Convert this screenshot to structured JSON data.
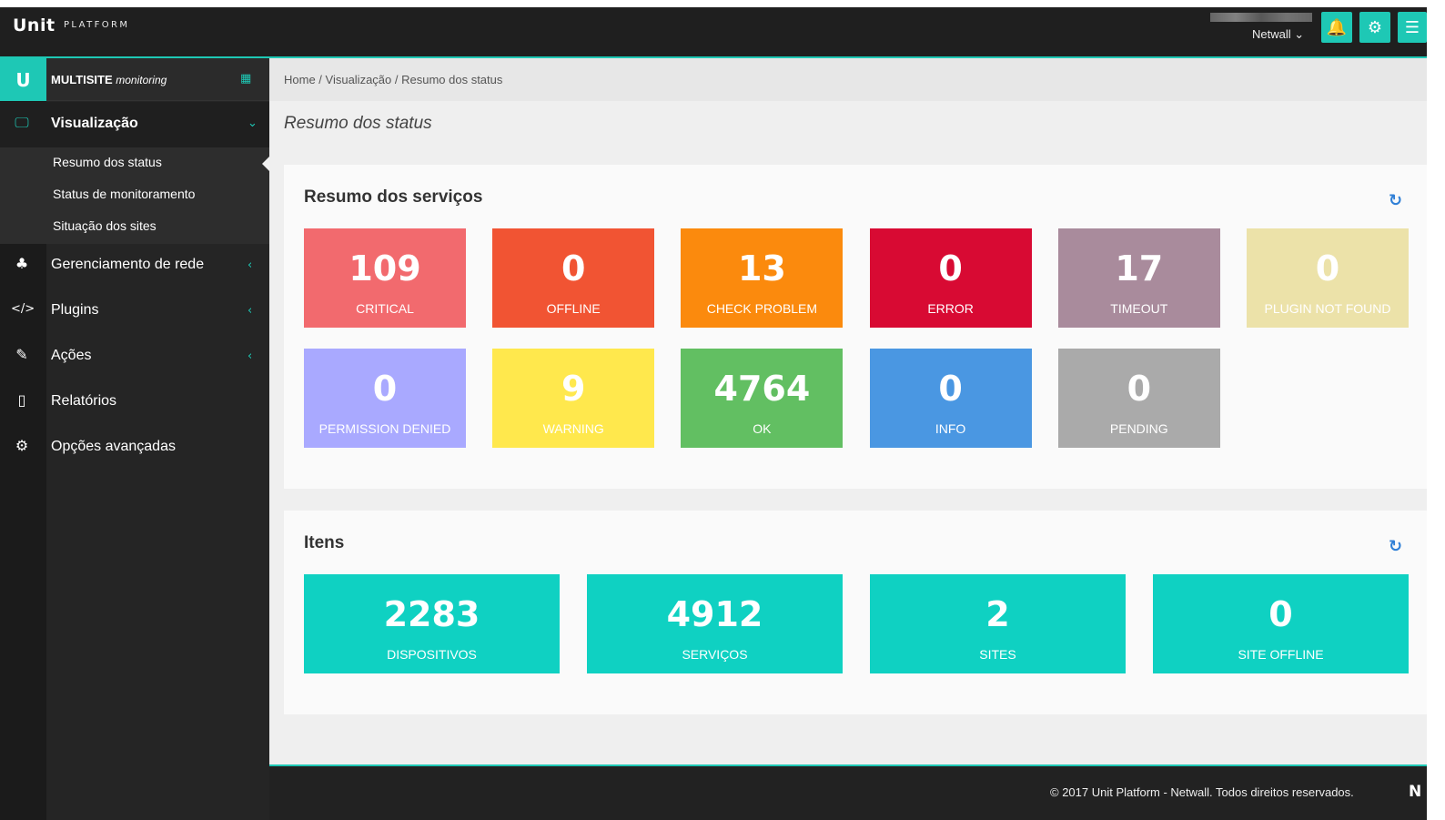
{
  "header": {
    "brand": "Unit",
    "brand_sub": "PLATFORM",
    "user_name": "Netwall ⌄",
    "colors": {
      "accent": "#1ec8b5",
      "bar": "#1f1f1f"
    }
  },
  "sidebar": {
    "logo": "U",
    "title": "MULTISITE",
    "title_sub": "monitoring",
    "items": [
      {
        "label": "Visualização",
        "icon": "monitor-icon",
        "glyph": "🖵",
        "chevron": "⌄"
      },
      {
        "label": "Gerenciamento de rede",
        "icon": "sitemap-icon",
        "glyph": "♣",
        "chevron": "‹"
      },
      {
        "label": "Plugins",
        "icon": "code-icon",
        "glyph": "</>",
        "chevron": "‹"
      },
      {
        "label": "Ações",
        "icon": "edit-icon",
        "glyph": "✎",
        "chevron": "‹"
      },
      {
        "label": "Relatórios",
        "icon": "pdf-icon",
        "glyph": "▯",
        "chevron": ""
      },
      {
        "label": "Opções avançadas",
        "icon": "gears-icon",
        "glyph": "⚙",
        "chevron": ""
      }
    ],
    "submenu": [
      "Resumo dos status",
      "Status de monitoramento",
      "Situação dos sites"
    ]
  },
  "breadcrumb": "Home /  Visualização /  Resumo dos status",
  "page_title": "Resumo dos status",
  "services_panel": {
    "title": "Resumo dos serviços",
    "tiles": [
      {
        "value": "109",
        "label": "CRITICAL",
        "color": "#f26a6e"
      },
      {
        "value": "0",
        "label": "OFFLINE",
        "color": "#f15433"
      },
      {
        "value": "13",
        "label": "CHECK PROBLEM",
        "color": "#fb8a0d"
      },
      {
        "value": "0",
        "label": "ERROR",
        "color": "#d80a33"
      },
      {
        "value": "17",
        "label": "TIMEOUT",
        "color": "#a98b9c"
      },
      {
        "value": "0",
        "label": "PLUGIN NOT FOUND",
        "color": "#ece2a9"
      },
      {
        "value": "0",
        "label": "PERMISSION DENIED",
        "color": "#a9a9ff"
      },
      {
        "value": "9",
        "label": "WARNING",
        "color": "#ffe84d"
      },
      {
        "value": "4764",
        "label": "OK",
        "color": "#62bf62"
      },
      {
        "value": "0",
        "label": "INFO",
        "color": "#4a97e2"
      },
      {
        "value": "0",
        "label": "PENDING",
        "color": "#aaaaaa"
      }
    ]
  },
  "items_panel": {
    "title": "Itens",
    "tiles": [
      {
        "value": "2283",
        "label": "DISPOSITIVOS"
      },
      {
        "value": "4912",
        "label": "SERVIÇOS"
      },
      {
        "value": "2",
        "label": "SITES"
      },
      {
        "value": "0",
        "label": "SITE OFFLINE"
      }
    ],
    "color": "#0fd1c2"
  },
  "footer": {
    "text": "© 2017  Unit Platform - Netwall. Todos direitos reservados.",
    "logo": "N"
  }
}
